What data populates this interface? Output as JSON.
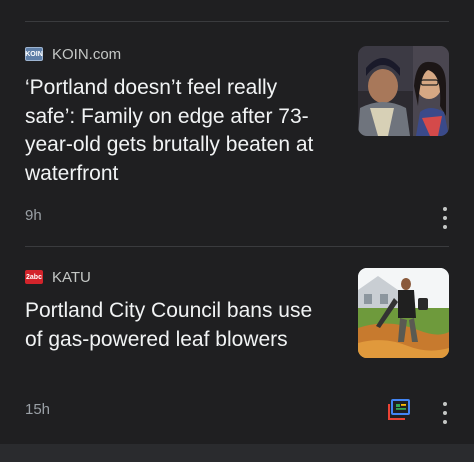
{
  "articles": [
    {
      "source": "KOIN.com",
      "source_logo": "koin-logo",
      "headline": "‘Portland doesn’t feel really safe’: Family on edge after 73-year-old gets brutally beaten at waterfront",
      "time": "9h",
      "thumbnail": "two-people-photo"
    },
    {
      "source": "KATU",
      "source_logo": "katu-2-abc-logo",
      "headline": "Portland City Council bans use of gas-powered leaf blowers",
      "time": "15h",
      "thumbnail": "man-with-leaf-blower-photo"
    }
  ],
  "logos": {
    "koin_text": "KOIN",
    "katu_text": "2abc"
  },
  "colors": {
    "background": "#1f1f21",
    "katu_red": "#d3242b",
    "koin_blue": "#5f7fa8"
  }
}
